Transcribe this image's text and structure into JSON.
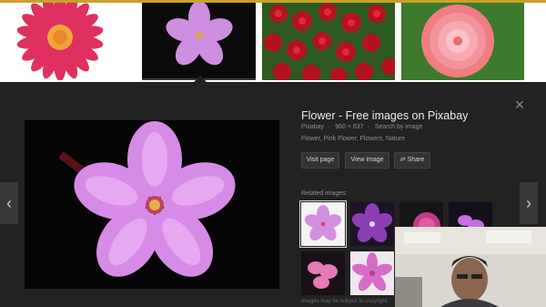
{
  "colors": {
    "panel_bg": "#222222",
    "strip_bg": "#ffffff",
    "top_border": "#c9a227",
    "title_text": "#ececec",
    "meta_text": "#8f8f8f"
  },
  "thumbnails": [
    {
      "name": "pink-gerbera"
    },
    {
      "name": "pink-phlox",
      "selected": true
    },
    {
      "name": "red-roses"
    },
    {
      "name": "pink-dahlia"
    }
  ],
  "panel": {
    "title": "Flower - Free images on Pixabay",
    "meta": {
      "site": "Pixabay",
      "dimensions": "960 × 637",
      "search_by_image": "Search by image"
    },
    "tags": "Flower, Pink Flower, Flowers, Nature",
    "buttons": {
      "visit": "Visit page",
      "view": "View image",
      "share": "Share"
    },
    "related_label": "Related images:",
    "copyright_note": "Images may be subject to copyright.",
    "close_icon": "×",
    "prev_icon": "‹",
    "next_icon": "›",
    "share_icon": "⇄"
  }
}
